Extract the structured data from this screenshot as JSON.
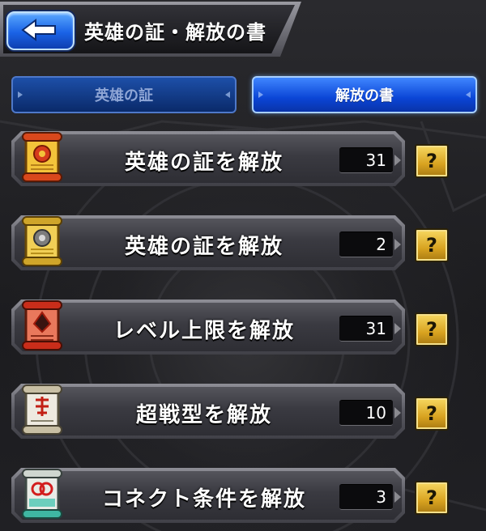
{
  "header": {
    "title": "英雄の証・解放の書",
    "back_icon": "back-arrow-icon"
  },
  "tabs": [
    {
      "label": "英雄の証",
      "active": false
    },
    {
      "label": "解放の書",
      "active": true
    }
  ],
  "items": [
    {
      "label": "英雄の証を解放",
      "count": "31",
      "icon": "gold-scroll-red-seal-icon",
      "help": "?"
    },
    {
      "label": "英雄の証を解放",
      "count": "2",
      "icon": "gold-scroll-gray-seal-icon",
      "help": "?"
    },
    {
      "label": "レベル上限を解放",
      "count": "31",
      "icon": "red-scroll-icon",
      "help": "?"
    },
    {
      "label": "超戦型を解放",
      "count": "10",
      "icon": "white-scroll-icon",
      "help": "?"
    },
    {
      "label": "コネクト条件を解放",
      "count": "3",
      "icon": "teal-scroll-icon",
      "help": "?"
    }
  ],
  "colors": {
    "accent_blue": "#1a63e6",
    "help_gold": "#d8a320",
    "panel_gray": "#3a3a41"
  }
}
